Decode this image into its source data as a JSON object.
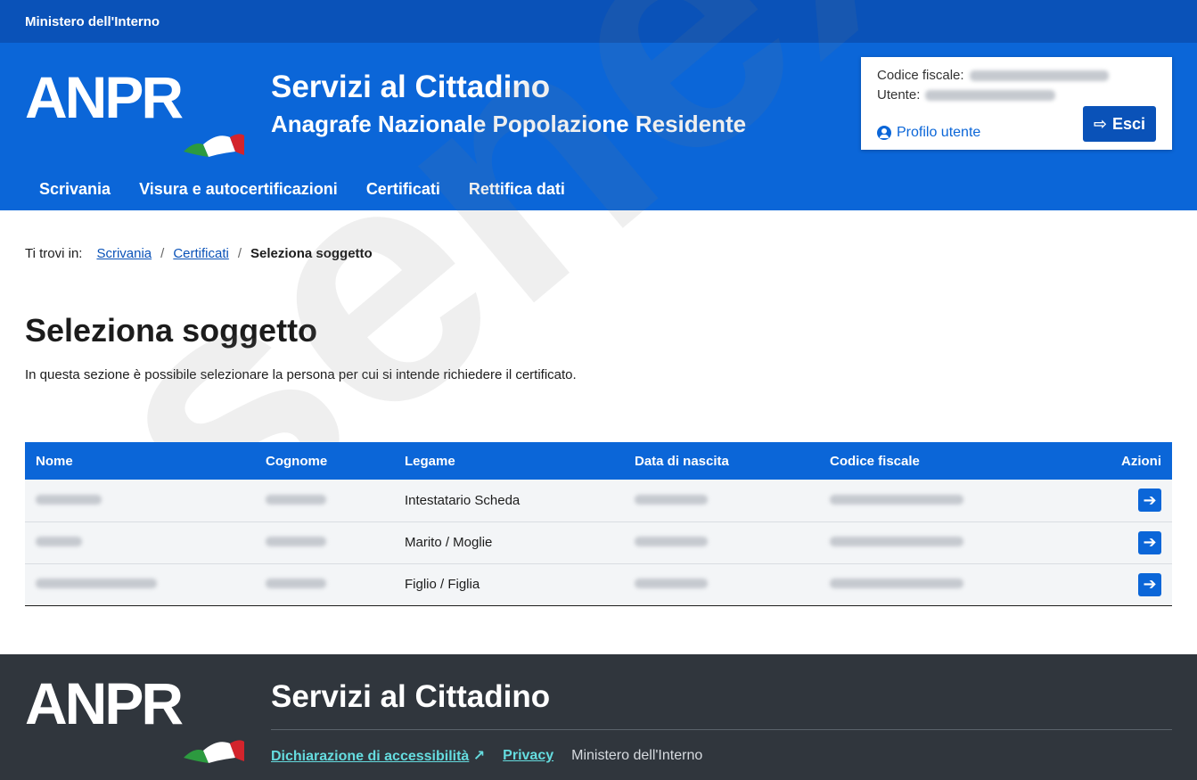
{
  "top_strip": {
    "ministry": "Ministero dell'Interno"
  },
  "header": {
    "logo_text": "ANPR",
    "title": "Servizi al Cittadino",
    "subtitle": "Anagrafe Nazionale Popolazione Residente",
    "user_box": {
      "fiscal_code_label": "Codice fiscale:",
      "user_label": "Utente:",
      "profile_link": "Profilo utente",
      "logout_label": "Esci"
    }
  },
  "nav": {
    "items": [
      "Scrivania",
      "Visura e autocertificazioni",
      "Certificati",
      "Rettifica dati"
    ]
  },
  "breadcrumb": {
    "prefix": "Ti trovi in:",
    "link1": "Scrivania",
    "link2": "Certificati",
    "current": "Seleziona soggetto",
    "separator": "/"
  },
  "main": {
    "title": "Seleziona soggetto",
    "description": "In questa sezione è possibile selezionare la persona per cui si intende richiedere il certificato."
  },
  "table": {
    "headers": [
      "Nome",
      "Cognome",
      "Legame",
      "Data di nascita",
      "Codice fiscale",
      "Azioni"
    ],
    "rows": [
      {
        "legame": "Intestatario Scheda"
      },
      {
        "legame": "Marito / Moglie"
      },
      {
        "legame": "Figlio / Figlia"
      }
    ]
  },
  "footer": {
    "logo_text": "ANPR",
    "title": "Servizi al Cittadino",
    "accessibility_link": "Dichiarazione di accessibilità",
    "privacy_link": "Privacy",
    "ministry": "Ministero dell'Interno"
  },
  "watermark": "senex.it",
  "colors": {
    "primary": "#0b66d8",
    "top_strip": "#0a52b8",
    "footer_bg": "#30363d",
    "footer_link": "#65dcdf"
  }
}
